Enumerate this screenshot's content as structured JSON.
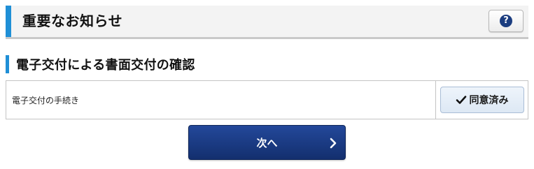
{
  "header": {
    "title": "重要なお知らせ",
    "help_icon_glyph": "?"
  },
  "section": {
    "title": "電子交付による書面交付の確認"
  },
  "procedure": {
    "label": "電子交付の手続き",
    "status_button_label": "同意済み"
  },
  "footer": {
    "next_button_label": "次へ"
  },
  "colors": {
    "accent_blue": "#1f8fd6",
    "primary_button": "#1b3d80",
    "agreed_button_bg": "#e5eef8"
  },
  "icons": {
    "help": "question-circle-icon",
    "check": "check-icon",
    "next": "chevron-right-icon"
  }
}
